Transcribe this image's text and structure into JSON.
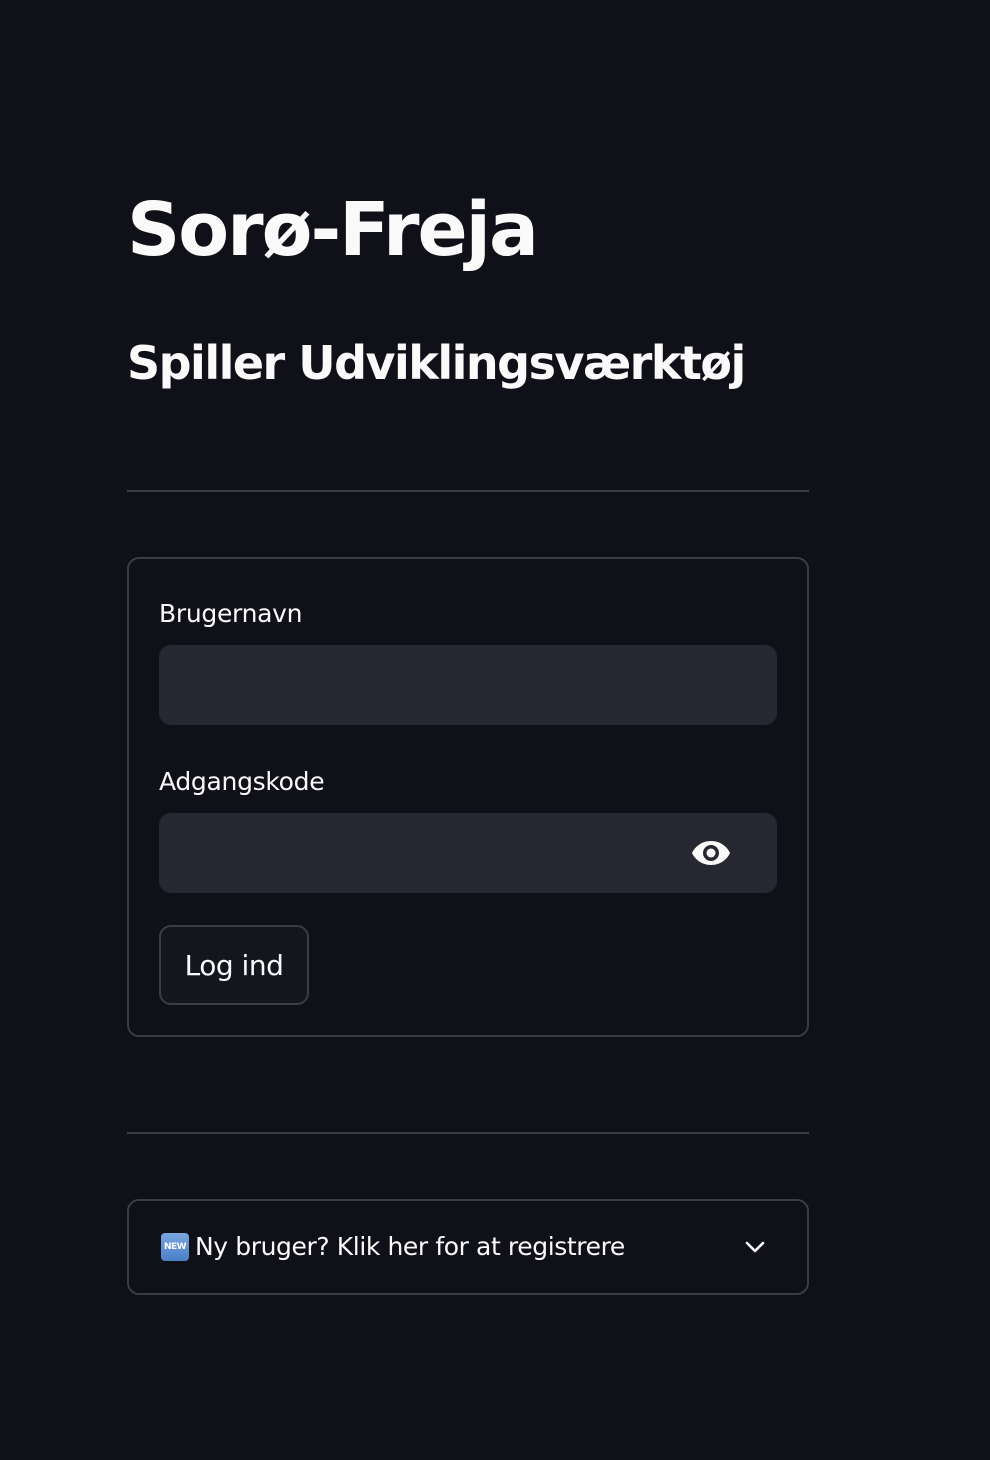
{
  "header": {
    "title": "Sorø-Freja",
    "subtitle": "Spiller Udviklingsværktøj"
  },
  "login_form": {
    "username": {
      "label": "Brugernavn",
      "value": "",
      "placeholder": ""
    },
    "password": {
      "label": "Adgangskode",
      "value": "",
      "placeholder": "",
      "visibility_icon": "eye-icon"
    },
    "submit_label": "Log ind"
  },
  "register_expander": {
    "badge_icon": "new-button-emoji",
    "badge_text": "NEW",
    "label": "Ny bruger? Klik her for at registrere",
    "chevron_icon": "chevron-down-icon",
    "expanded": false
  },
  "colors": {
    "background": "#101118",
    "text": "#fafafa",
    "input_background": "#262730",
    "border": "#3b3d45"
  }
}
